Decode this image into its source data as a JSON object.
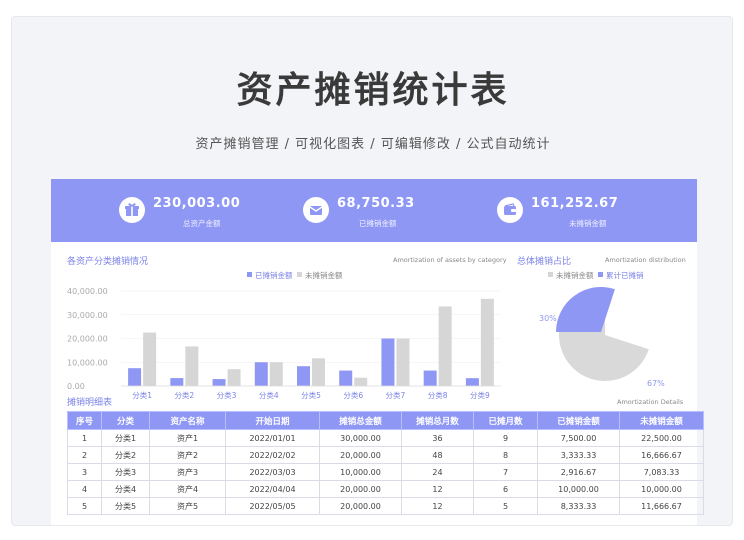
{
  "header": {
    "title": "资产摊销统计表",
    "subtitle": "资产摊销管理 / 可视化图表 / 可编辑修改 / 公式自动统计"
  },
  "kpis": [
    {
      "value": "230,003.00",
      "label": "总资产金额",
      "icon": "gift-icon"
    },
    {
      "value": "68,750.33",
      "label": "已摊销金额",
      "icon": "envelope-icon"
    },
    {
      "value": "161,252.67",
      "label": "未摊销金额",
      "icon": "wallet-icon"
    }
  ],
  "bar_section": {
    "title": "各资产分类摊销情况",
    "subtitle": "Amortization of assets by category"
  },
  "pie_section": {
    "title": "总体摊销占比",
    "subtitle": "Amortization distribution"
  },
  "table_section": {
    "title": "摊销明细表",
    "subtitle": "Amortization Details",
    "columns": [
      "序号",
      "分类",
      "资产名称",
      "开始日期",
      "摊销总金额",
      "摊销总月数",
      "已摊月数",
      "已摊销金额",
      "未摊销金额"
    ],
    "rows": [
      [
        "1",
        "分类1",
        "资产1",
        "2022/01/01",
        "30,000.00",
        "36",
        "9",
        "7,500.00",
        "22,500.00"
      ],
      [
        "2",
        "分类2",
        "资产2",
        "2022/02/02",
        "20,000.00",
        "48",
        "8",
        "3,333.33",
        "16,666.67"
      ],
      [
        "3",
        "分类3",
        "资产3",
        "2022/03/03",
        "10,000.00",
        "24",
        "7",
        "2,916.67",
        "7,083.33"
      ],
      [
        "4",
        "分类4",
        "资产4",
        "2022/04/04",
        "20,000.00",
        "12",
        "6",
        "10,000.00",
        "10,000.00"
      ],
      [
        "5",
        "分类5",
        "资产5",
        "2022/05/05",
        "20,000.00",
        "12",
        "5",
        "8,333.33",
        "11,666.67"
      ]
    ]
  },
  "colors": {
    "accent": "#8f97f4",
    "series_done": "#8f97f4",
    "series_remaining": "#d6d6d6"
  },
  "chart_data": [
    {
      "type": "bar",
      "categories": [
        "分类1",
        "分类2",
        "分类3",
        "分类4",
        "分类5",
        "分类6",
        "分类7",
        "分类8",
        "分类9"
      ],
      "series": [
        {
          "name": "已摊销金额",
          "values": [
            7500,
            3333.33,
            2916.67,
            10000,
            8333.33,
            6500,
            20000,
            6500,
            3300
          ]
        },
        {
          "name": "未摊销金额",
          "values": [
            22500,
            16666.67,
            7083.33,
            10000,
            11666.67,
            3500,
            20000,
            33500,
            36700
          ]
        }
      ],
      "yticks": [
        "0.00",
        "10,000.00",
        "20,000.00",
        "30,000.00",
        "40,000.00"
      ],
      "ylim": [
        0,
        40000
      ],
      "legend": "top"
    },
    {
      "type": "pie",
      "labels": [
        "未摊销金额",
        "累计已摊销"
      ],
      "values": [
        30,
        70
      ],
      "data_labels": [
        "30%",
        "67%"
      ],
      "legend": "top"
    }
  ]
}
